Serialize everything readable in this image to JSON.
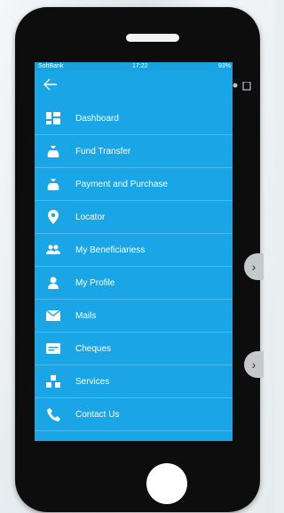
{
  "status_bar": {
    "carrier": "SoftBank",
    "time": "17:22",
    "battery": "93%"
  },
  "drawer": {
    "items": [
      {
        "label": "Dashboard",
        "icon": "dashboard-icon"
      },
      {
        "label": "Fund Transfer",
        "icon": "money-bag-icon"
      },
      {
        "label": "Payment and Purchase",
        "icon": "money-bag-icon"
      },
      {
        "label": "Locator",
        "icon": "location-pin-icon"
      },
      {
        "label": "My Beneficiariess",
        "icon": "people-icon"
      },
      {
        "label": "My Profile",
        "icon": "person-icon"
      },
      {
        "label": "Mails",
        "icon": "mail-icon"
      },
      {
        "label": "Cheques",
        "icon": "cheque-icon"
      },
      {
        "label": "Services",
        "icon": "services-icon"
      },
      {
        "label": "Contact Us",
        "icon": "phone-icon"
      }
    ]
  },
  "colors": {
    "drawer": "#1aa5e6",
    "app_bar": "#1f94c6",
    "phone_body": "#0d0d0d"
  }
}
